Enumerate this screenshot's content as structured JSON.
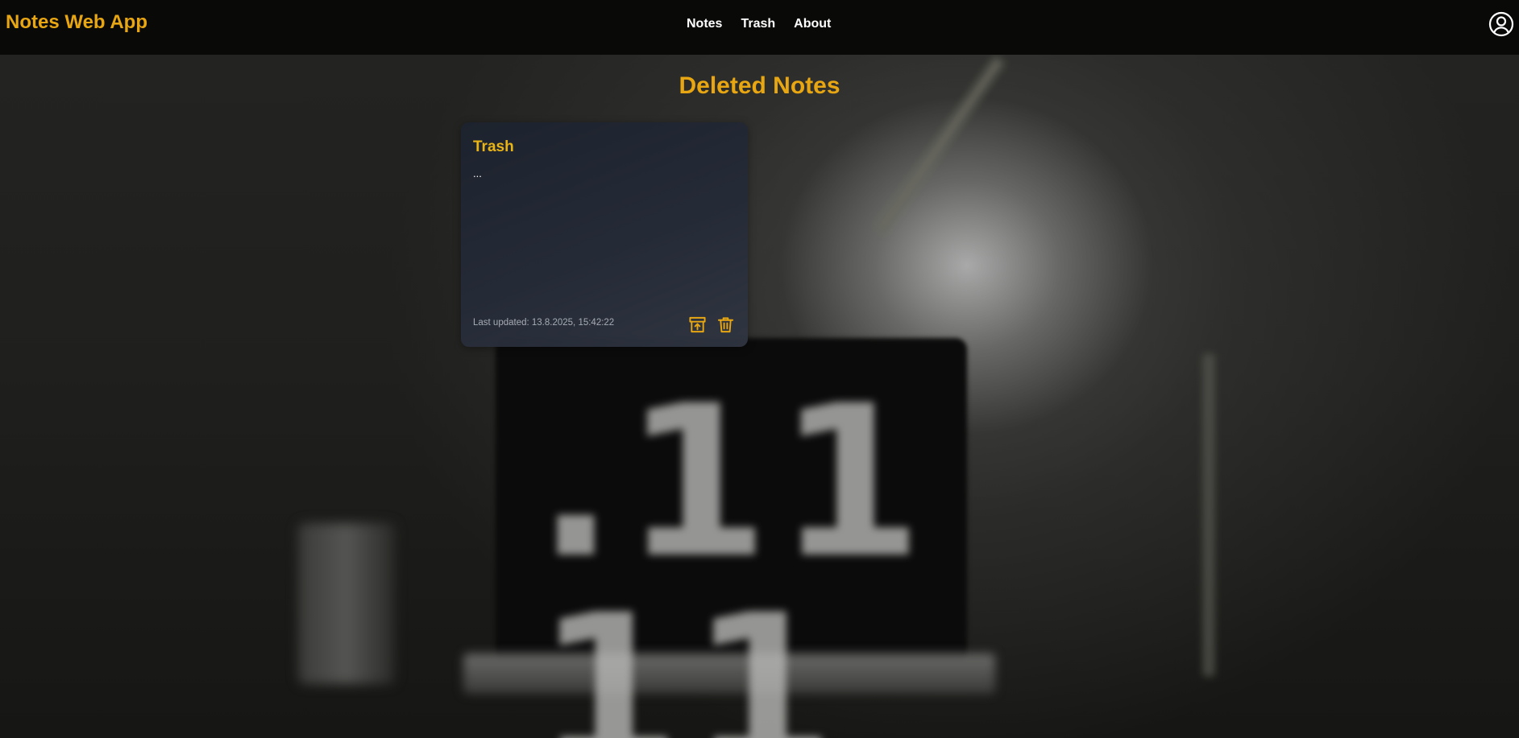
{
  "app": {
    "title": "Notes Web App"
  },
  "nav": {
    "links": [
      {
        "label": "Notes"
      },
      {
        "label": "Trash"
      },
      {
        "label": "About"
      }
    ],
    "user_icon": "user-circle-icon"
  },
  "page": {
    "title": "Deleted Notes"
  },
  "notes": [
    {
      "title": "Trash",
      "content": "...",
      "updated": "Last updated: 13.8.2025, 15:42:22",
      "actions": [
        "restore-icon",
        "trash-can-icon"
      ]
    }
  ],
  "colors": {
    "accent": "#e8a712",
    "navbar": "#080807",
    "card": "#1d232e",
    "text": "#ffffff",
    "muted": "#a6abb3"
  },
  "background": {
    "clock_digits": ".11 11"
  }
}
